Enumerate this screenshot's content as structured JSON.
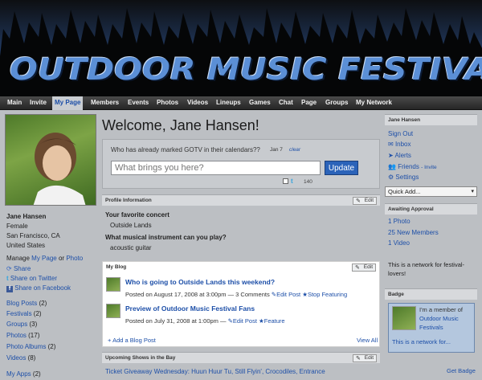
{
  "header": {
    "title": "OUTDOOR MUSIC FESTIVALS"
  },
  "nav": {
    "items": [
      "Main",
      "Invite",
      "My Page",
      "Members",
      "Events",
      "Photos",
      "Videos",
      "Lineups",
      "Games",
      "Chat",
      "Page",
      "Groups",
      "My Network"
    ],
    "active": "My Page"
  },
  "profile": {
    "name": "Jane Hansen",
    "gender": "Female",
    "city": "San Francisco, CA",
    "country": "United States",
    "manage_prefix": "Manage",
    "manage_page": "My Page",
    "manage_or": "or",
    "manage_photo": "Photo",
    "share": "Share",
    "share_twitter": "Share on Twitter",
    "share_facebook": "Share on Facebook",
    "links": [
      {
        "label": "Blog Posts",
        "count": "(2)"
      },
      {
        "label": "Festivals",
        "count": "(2)"
      },
      {
        "label": "Groups",
        "count": "(3)"
      },
      {
        "label": "Photos",
        "count": "(17)"
      },
      {
        "label": "Photo Albums",
        "count": "(2)"
      },
      {
        "label": "Videos",
        "count": "(8)"
      }
    ],
    "my_apps": "My Apps",
    "my_apps_count": "(2)"
  },
  "main": {
    "welcome": "Welcome, Jane Hansen!",
    "status": {
      "question": "Who has already marked GOTV in their calendars??",
      "date": "Jan 7",
      "clear": "clear",
      "placeholder": "What brings you here?",
      "update": "Update",
      "count": "140"
    },
    "profile_info": {
      "heading": "Profile Information",
      "edit": "Edit",
      "q1": "Your favorite concert",
      "a1": "Outside Lands",
      "q2": "What musical instrument can you play?",
      "a2": "acoustic guitar"
    },
    "blog": {
      "heading": "My Blog",
      "edit": "Edit",
      "posts": [
        {
          "title": "Who is going to Outside Lands this weekend?",
          "meta": "Posted on August 17, 2008 at 3:00pm — 3 Comments",
          "edit": "Edit Post",
          "action": "Stop Featuring"
        },
        {
          "title": "Preview of Outdoor Music Festival Fans",
          "meta": "Posted on July 31, 2008 at 1:00pm —",
          "edit": "Edit Post",
          "action": "Feature"
        }
      ],
      "add": "Add a Blog Post",
      "view_all": "View All"
    },
    "shows": {
      "heading": "Upcoming Shows in the Bay",
      "edit": "Edit",
      "item": "Ticket Giveaway Wednesday: Huun Huur Tu, Still Flyin', Crocodiles, Entrance"
    }
  },
  "sidebar": {
    "user_heading": "Jane Hansen",
    "sign_out": "Sign Out",
    "inbox": "Inbox",
    "alerts": "Alerts",
    "friends": "Friends",
    "invite": "- Invite",
    "settings": "Settings",
    "quick_add": "Quick Add...",
    "awaiting_heading": "Awaiting Approval",
    "awaiting": [
      "1 Photo",
      "25 New Members",
      "1 Video"
    ],
    "network_note_1": "This is a network for festival-",
    "network_note_2": "lovers!",
    "badge_heading": "Badge",
    "badge_line1": "I'm a member of",
    "badge_line2": "Outdoor Music",
    "badge_line3": "Festivals",
    "badge_desc": "This is a network for...",
    "get_badge": "Get Badge"
  }
}
